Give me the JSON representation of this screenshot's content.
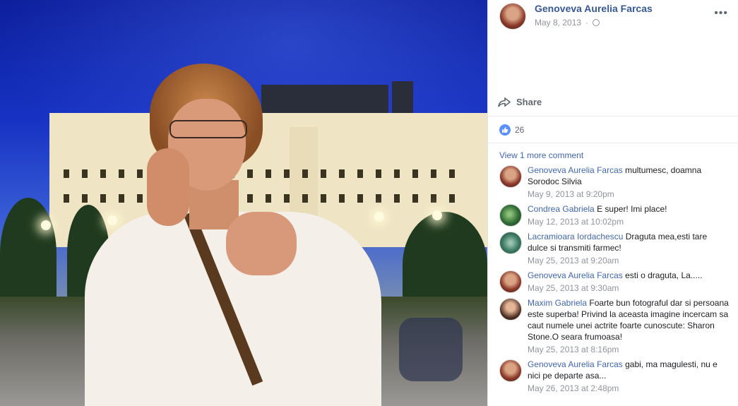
{
  "post": {
    "author": "Genoveva Aurelia Farcas",
    "date": "May 8, 2013",
    "privacy_icon": "globe-icon",
    "more_icon": "ellipsis-icon"
  },
  "actions": {
    "share_label": "Share"
  },
  "reactions": {
    "count": "26",
    "icon": "like-icon",
    "color": "#5890ff"
  },
  "comments_section": {
    "view_more": "View 1 more comment",
    "items": [
      {
        "name": "Genoveva Aurelia Farcas",
        "text": "multumesc, doamna Sorodoc Silvia",
        "time": "May 9, 2013 at 9:20pm"
      },
      {
        "name": "Condrea Gabriela",
        "text": "E super! Imi place!",
        "time": "May 12, 2013 at 10:02pm"
      },
      {
        "name": "Lacramioara Iordachescu",
        "text": "Draguta mea,esti tare dulce si transmiti farmec!",
        "time": "May 25, 2013 at 9:20am"
      },
      {
        "name": "Genoveva Aurelia Farcas",
        "text": "esti o draguta, La.....",
        "time": "May 25, 2013 at 9:30am"
      },
      {
        "name": "Maxim Gabriela",
        "text": "Foarte bun fotograful dar si persoana este superba! Privind la aceasta imagine incercam sa caut numele unei actrite foarte cunoscute: Sharon Stone.O seara frumoasa!",
        "time": "May 25, 2013 at 8:16pm"
      },
      {
        "name": "Genoveva Aurelia Farcas",
        "text": "gabi, ma magulesti, nu e nici pe departe asa...",
        "time": "May 26, 2013 at 2:48pm"
      }
    ]
  },
  "colors": {
    "link": "#365899",
    "meta": "#90949c",
    "text": "#1c1e21"
  }
}
